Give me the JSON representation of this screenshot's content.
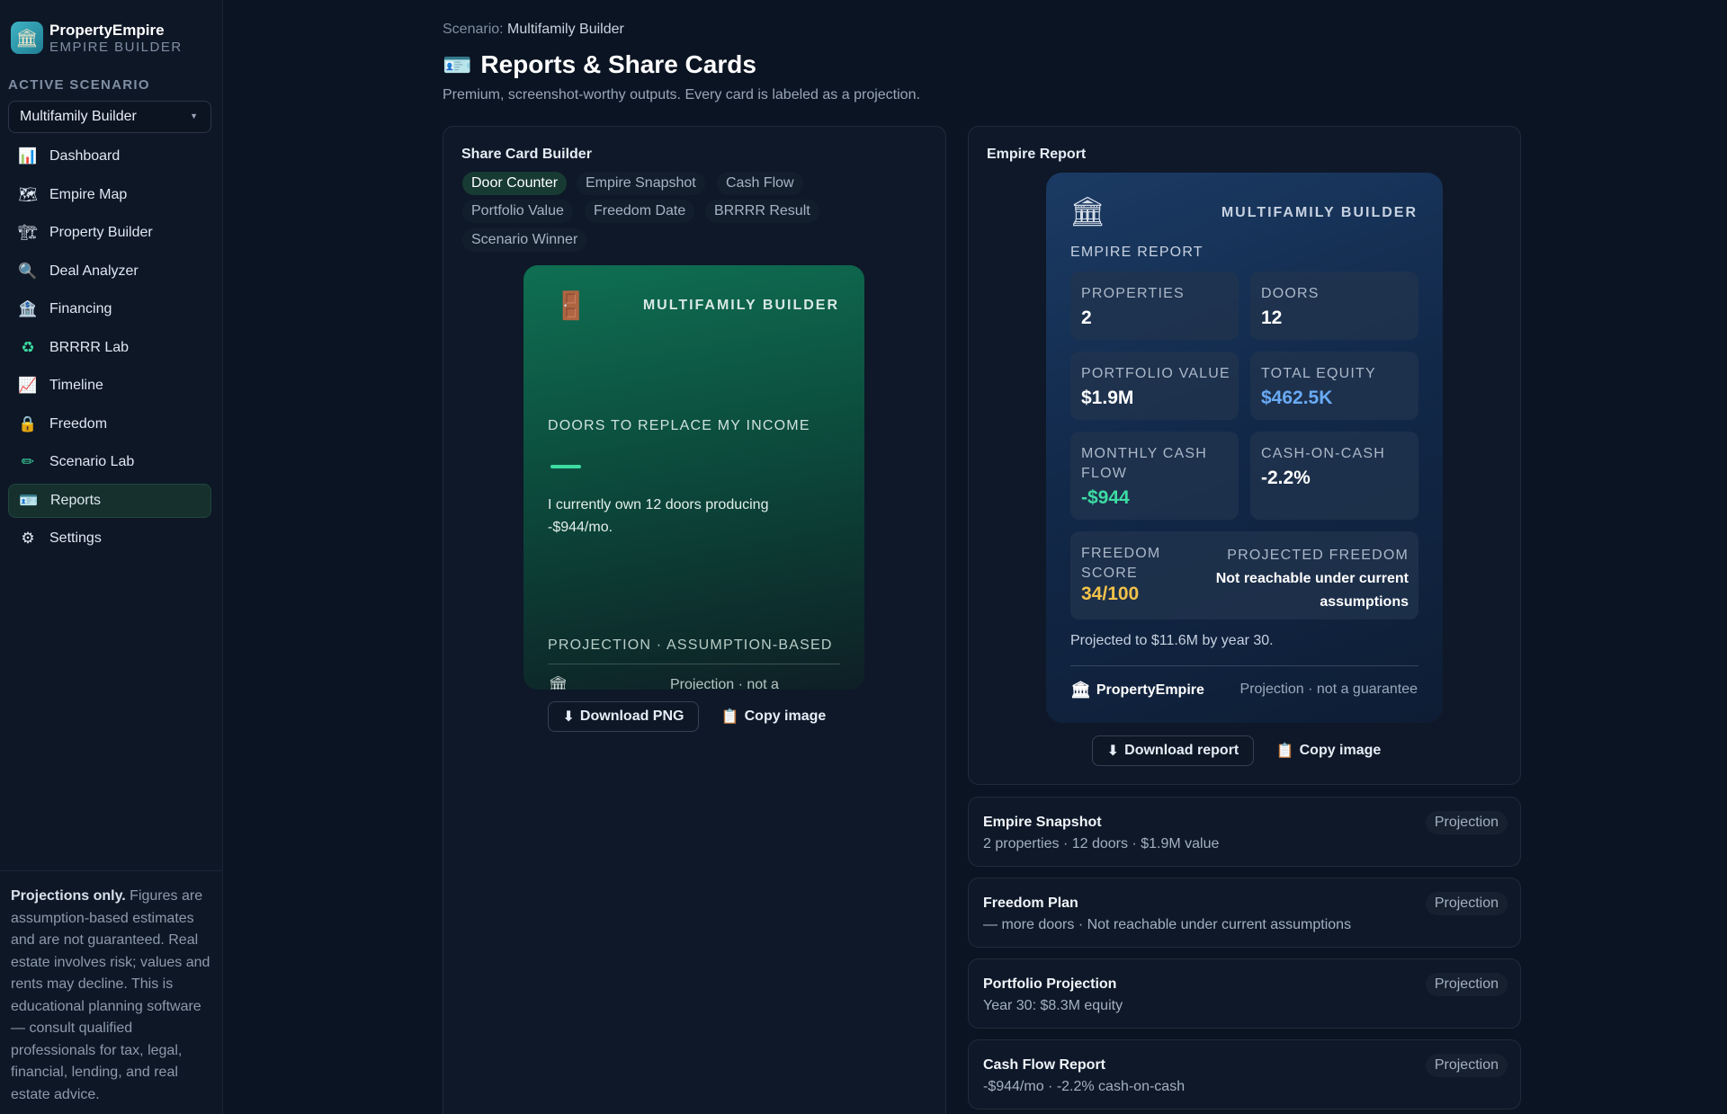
{
  "app": {
    "name": "PropertyEmpire",
    "subtitle": "EMPIRE BUILDER"
  },
  "sidebar": {
    "section_label": "ACTIVE SCENARIO",
    "scenario": "Multifamily Builder",
    "items": [
      {
        "label": "Dashboard",
        "icon": "bar-chart-icon"
      },
      {
        "label": "Empire Map",
        "icon": "map-icon"
      },
      {
        "label": "Property Builder",
        "icon": "crane-icon"
      },
      {
        "label": "Deal Analyzer",
        "icon": "magnifier-icon"
      },
      {
        "label": "Financing",
        "icon": "bank-icon"
      },
      {
        "label": "BRRRR Lab",
        "icon": "recycle-icon"
      },
      {
        "label": "Timeline",
        "icon": "trend-chart-icon"
      },
      {
        "label": "Freedom",
        "icon": "lock-icon"
      },
      {
        "label": "Scenario Lab",
        "icon": "pencil-icon"
      },
      {
        "label": "Reports",
        "icon": "id-card-icon"
      },
      {
        "label": "Settings",
        "icon": "gear-icon"
      }
    ],
    "active_item": "Reports",
    "footer_bold": "Projections only.",
    "footer_text": " Figures are assumption-based estimates and are not guaranteed. Real estate involves risk; values and rents may decline. This is educational planning software — consult qualified professionals for tax, legal, financial, lending, and real estate advice."
  },
  "header": {
    "breadcrumb_label": "Scenario:",
    "breadcrumb_value": "Multifamily Builder",
    "title": "Reports & Share Cards",
    "subtitle": "Premium, screenshot-worthy outputs. Every card is labeled as a projection."
  },
  "share_builder": {
    "title": "Share Card Builder",
    "chips": [
      "Door Counter",
      "Empire Snapshot",
      "Cash Flow",
      "Portfolio Value",
      "Freedom Date",
      "BRRRR Result",
      "Scenario Winner"
    ],
    "active_chip": "Door Counter",
    "card": {
      "scenario": "MULTIFAMILY BUILDER",
      "headline": "DOORS TO REPLACE MY INCOME",
      "body": "I currently own 12 doors producing -$944/mo.",
      "projection_label": "PROJECTION · ASSUMPTION-BASED",
      "footer_text": "Projection · not a"
    },
    "download_label": "Download PNG",
    "copy_label": "Copy image"
  },
  "empire_report": {
    "title": "Empire Report",
    "card": {
      "scenario": "MULTIFAMILY BUILDER",
      "heading": "EMPIRE REPORT",
      "properties_label": "PROPERTIES",
      "properties_value": "2",
      "doors_label": "DOORS",
      "doors_value": "12",
      "portfolio_label": "PORTFOLIO VALUE",
      "portfolio_value": "$1.9M",
      "equity_label": "TOTAL EQUITY",
      "equity_value": "$462.5K",
      "cashflow_label_1": "MONTHLY CASH",
      "cashflow_label_2": "FLOW",
      "cashflow_value": "-$944",
      "coc_label": "CASH-ON-CASH",
      "coc_value": "-2.2%",
      "freedom_label_1": "FREEDOM",
      "freedom_label_2": "SCORE",
      "freedom_value": "34/100",
      "projected_label": "PROJECTED FREEDOM",
      "projected_value_1": "Not reachable under current",
      "projected_value_2": "assumptions",
      "note": "Projected to $11.6M by year 30.",
      "brand": "PropertyEmpire",
      "disclaimer": "Projection · not a guarantee"
    },
    "download_label": "Download report",
    "copy_label": "Copy image"
  },
  "report_list": [
    {
      "title": "Empire Snapshot",
      "sub": "2 properties · 12 doors · $1.9M value",
      "badge": "Projection"
    },
    {
      "title": "Freedom Plan",
      "sub": "— more doors · Not reachable under current assumptions",
      "badge": "Projection"
    },
    {
      "title": "Portfolio Projection",
      "sub": "Year 30: $8.3M equity",
      "badge": "Projection"
    },
    {
      "title": "Cash Flow Report",
      "sub": "-$944/mo · -2.2% cash-on-cash",
      "badge": "Projection"
    }
  ],
  "colors": {
    "accent_green": "#3ddca3",
    "equity_blue": "#6aaaf5",
    "freedom_gold": "#f2c24a",
    "active_nav_bg": "#16312d"
  }
}
